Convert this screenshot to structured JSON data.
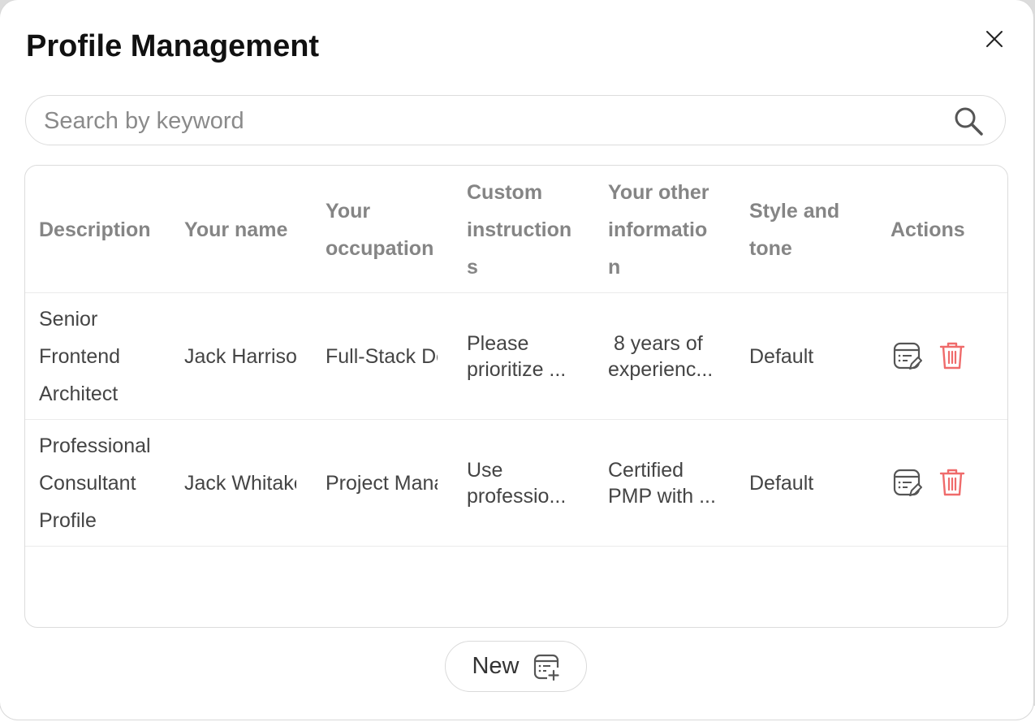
{
  "dialog": {
    "title": "Profile Management"
  },
  "search": {
    "placeholder": "Search by keyword"
  },
  "table": {
    "headers": {
      "description": "Description",
      "name": "Your name",
      "occupation_1": "Your",
      "occupation_2": "occupation",
      "custom_1": "Custom",
      "custom_2": "instruction",
      "custom_3": "s",
      "other_1": "Your other",
      "other_2": "informatio",
      "other_3": "n",
      "style_1": "Style and",
      "style_2": "tone",
      "actions": "Actions"
    },
    "rows": [
      {
        "desc_1": "Senior",
        "desc_2": "Frontend",
        "desc_3": "Architect",
        "name": "Jack Harrison",
        "occupation": "Full-Stack Developer",
        "custom_1": "Please",
        "custom_2": "prioritize ...",
        "other_1": " 8 years of",
        "other_2": "experienc...",
        "style": "Default"
      },
      {
        "desc_1": "Professional",
        "desc_2": "Consultant",
        "desc_3": "Profile",
        "name": "Jack Whitaker",
        "occupation": "Project Manager",
        "custom_1": "Use",
        "custom_2": "professio...",
        "other_1": "Certified",
        "other_2": "PMP with ...",
        "style": "Default"
      }
    ]
  },
  "footer": {
    "new_label": "New"
  },
  "colors": {
    "delete_icon": "#ef6b6b",
    "header_text": "#858585",
    "border": "#dcdcdc"
  },
  "icons": {
    "close": "close-icon",
    "search": "search-icon",
    "edit": "edit-profile-icon",
    "delete": "trash-icon",
    "new": "new-profile-icon"
  }
}
